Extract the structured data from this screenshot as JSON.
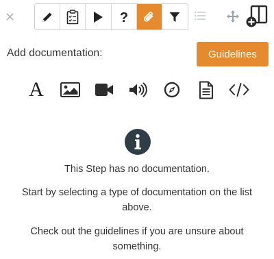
{
  "toolbar": {
    "close_icon": "close-icon",
    "tools": [
      {
        "name": "pencil-icon",
        "active": false
      },
      {
        "name": "clipboard-checklist-icon",
        "active": false
      },
      {
        "name": "play-icon",
        "active": false
      },
      {
        "name": "question-icon",
        "active": false
      },
      {
        "name": "paperclip-icon",
        "active": true
      },
      {
        "name": "filter-icon",
        "active": false
      }
    ],
    "extra_icons": [
      "list-icon",
      "move-icon",
      "add-panel-icon"
    ],
    "accent_color": "#e58a2e"
  },
  "documentation": {
    "label": "Add documentation:",
    "guidelines_button": "Guidelines",
    "types": [
      {
        "name": "text-type",
        "glyph": "A"
      },
      {
        "name": "image-type"
      },
      {
        "name": "video-type"
      },
      {
        "name": "audio-type"
      },
      {
        "name": "link-type"
      },
      {
        "name": "file-type"
      },
      {
        "name": "code-type"
      }
    ]
  },
  "empty_state": {
    "icon": "info-icon",
    "message": "This Step has no documentation.",
    "instruction": "Start by selecting a type of documentation on the list above.",
    "hint": "Check out the guidelines if you are unsure about something."
  }
}
